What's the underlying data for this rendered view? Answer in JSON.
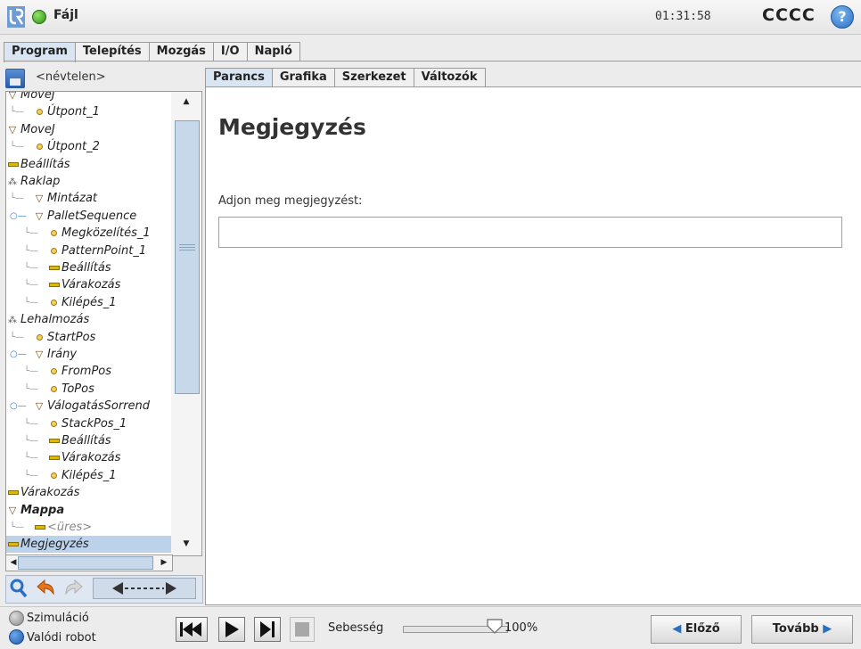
{
  "header": {
    "file_menu": "Fájl",
    "time": "01:31:58",
    "robot_name": "CCCC",
    "help_symbol": "?"
  },
  "main_tabs": [
    {
      "label": "Program",
      "active": true
    },
    {
      "label": "Telepítés",
      "active": false
    },
    {
      "label": "Mozgás",
      "active": false
    },
    {
      "label": "I/O",
      "active": false
    },
    {
      "label": "Napló",
      "active": false
    }
  ],
  "left": {
    "program_name": "<névtelen>",
    "tree": [
      {
        "label": "MoveJ",
        "indent": 0,
        "icon": "triangle-icon"
      },
      {
        "label": "Útpont_1",
        "indent": 1,
        "icon": "waypoint-icon"
      },
      {
        "label": "MoveJ",
        "indent": 0,
        "icon": "triangle-icon"
      },
      {
        "label": "Útpont_2",
        "indent": 1,
        "icon": "waypoint-icon"
      },
      {
        "label": "Beállítás",
        "indent": 0,
        "icon": "bar-icon"
      },
      {
        "label": "Raklap",
        "indent": 0,
        "icon": "pallet-icon"
      },
      {
        "label": "Mintázat",
        "indent": 1,
        "icon": "triangle-icon"
      },
      {
        "label": "PalletSequence",
        "indent": 1,
        "icon": "triangle-icon",
        "branch": true
      },
      {
        "label": "Megközelítés_1",
        "indent": 2,
        "icon": "waypoint-icon"
      },
      {
        "label": "PatternPoint_1",
        "indent": 2,
        "icon": "waypoint-icon"
      },
      {
        "label": "Beállítás",
        "indent": 2,
        "icon": "bar-icon"
      },
      {
        "label": "Várakozás",
        "indent": 2,
        "icon": "bar-icon"
      },
      {
        "label": "Kilépés_1",
        "indent": 2,
        "icon": "waypoint-icon"
      },
      {
        "label": "Lehalmozás",
        "indent": 0,
        "icon": "pallet-icon"
      },
      {
        "label": "StartPos",
        "indent": 1,
        "icon": "waypoint-icon"
      },
      {
        "label": "Irány",
        "indent": 1,
        "icon": "triangle-icon",
        "branch": true
      },
      {
        "label": "FromPos",
        "indent": 2,
        "icon": "waypoint-icon"
      },
      {
        "label": "ToPos",
        "indent": 2,
        "icon": "waypoint-icon"
      },
      {
        "label": "VálogatásSorrend",
        "indent": 1,
        "icon": "triangle-icon",
        "branch": true
      },
      {
        "label": "StackPos_1",
        "indent": 2,
        "icon": "waypoint-icon"
      },
      {
        "label": "Beállítás",
        "indent": 2,
        "icon": "bar-icon"
      },
      {
        "label": "Várakozás",
        "indent": 2,
        "icon": "bar-icon"
      },
      {
        "label": "Kilépés_1",
        "indent": 2,
        "icon": "waypoint-icon"
      },
      {
        "label": "Várakozás",
        "indent": 0,
        "icon": "bar-icon"
      },
      {
        "label": "Mappa",
        "indent": 0,
        "icon": "triangle-icon",
        "bold": true
      },
      {
        "label": "<üres>",
        "indent": 1,
        "icon": "bar-icon",
        "muted": true
      },
      {
        "label": "Megjegyzés",
        "indent": 0,
        "icon": "bar-icon",
        "selected": true
      }
    ]
  },
  "sub_tabs": [
    {
      "label": "Parancs",
      "active": true
    },
    {
      "label": "Grafika",
      "active": false
    },
    {
      "label": "Szerkezet",
      "active": false
    },
    {
      "label": "Változók",
      "active": false
    }
  ],
  "content": {
    "title": "Megjegyzés",
    "field_label": "Adjon meg megjegyzést:",
    "field_value": ""
  },
  "footer": {
    "simulation_label": "Szimuláció",
    "real_robot_label": "Valódi robot",
    "speed_label": "Sebesség",
    "speed_value": "100%",
    "speed_fraction": 1.0,
    "prev_label": "Előző",
    "next_label": "Tovább"
  },
  "colors": {
    "accent": "#2a6fc2",
    "selected_bg": "#bcd2ea",
    "active_tab": "#d9e5f2"
  }
}
